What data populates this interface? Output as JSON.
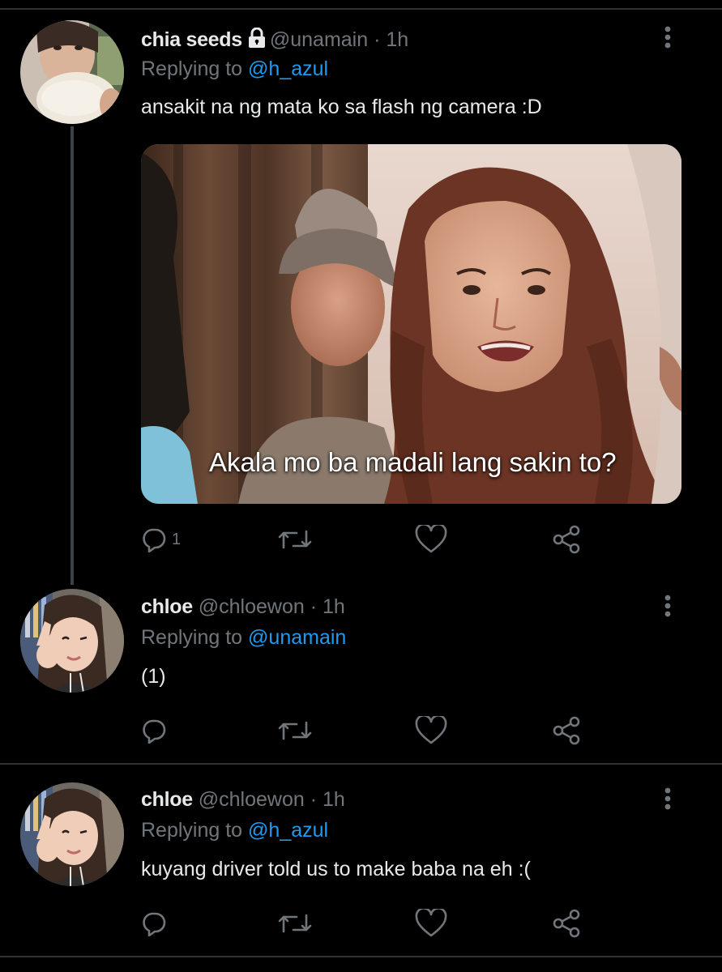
{
  "tweets": [
    {
      "name": "chia seeds",
      "handle": "@unamain",
      "time": "· 1h",
      "replying_label": "Replying to ",
      "replying_to": "@h_azul",
      "text": "ansakit na ng mata ko sa flash ng camera :D",
      "protected": true,
      "media_caption": "Akala mo ba madali lang sakin to?",
      "reply_count": "1"
    },
    {
      "name": "chloe",
      "handle": "@chloewon",
      "time": "· 1h",
      "replying_label": "Replying to ",
      "replying_to": "@unamain",
      "text": "(1)",
      "reply_count": ""
    },
    {
      "name": "chloe",
      "handle": "@chloewon",
      "time": "· 1h",
      "replying_label": "Replying to ",
      "replying_to": "@h_azul",
      "text": "kuyang driver told us to make baba na eh :(",
      "reply_count": ""
    }
  ],
  "colors": {
    "background": "#000000",
    "text_primary": "#e7e9ea",
    "text_secondary": "#71767b",
    "link": "#1d9bf0",
    "divider": "#2f3336"
  },
  "icons": [
    "lock-icon",
    "more-icon",
    "reply-icon",
    "retweet-icon",
    "like-icon",
    "share-icon"
  ]
}
